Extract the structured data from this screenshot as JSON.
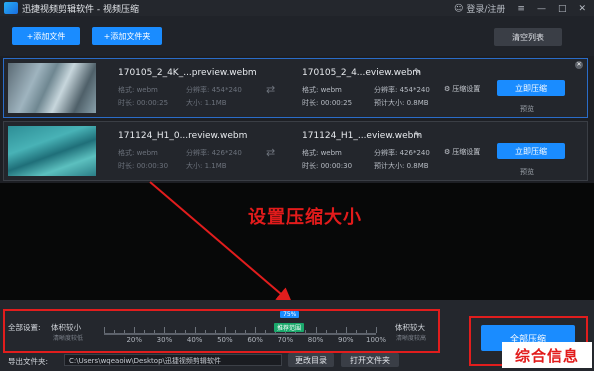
{
  "app": {
    "title": "迅捷视频剪辑软件 - 视频压缩",
    "login_label": "登录/注册",
    "window_controls": {
      "menu": "≡",
      "minimize": "—",
      "maximize": "□",
      "close": "✕"
    }
  },
  "toolbar": {
    "add_file": "+添加文件",
    "add_folder": "+添加文件夹",
    "clear_list": "清空列表"
  },
  "files": [
    {
      "source_name": "170105_2_4K_...preview.webm",
      "format_label": "格式: webm",
      "resolution_label": "分辨率: 454*240",
      "duration_label": "时长: 00:00:25",
      "size_label": "大小: 1.1MB",
      "output_name": "170105_2_4...eview.webm",
      "out_format": "格式: webm",
      "out_resolution": "分辨率: 454*240",
      "out_duration": "时长: 00:00:25",
      "out_size": "预计大小: 0.8MB",
      "compress_settings": "压缩设置",
      "compress_now": "立即压缩",
      "preview": "预览"
    },
    {
      "source_name": "171124_H1_0...review.webm",
      "format_label": "格式: webm",
      "resolution_label": "分辨率: 426*240",
      "duration_label": "时长: 00:00:30",
      "size_label": "大小: 1.1MB",
      "output_name": "171124_H1_...eview.webm",
      "out_format": "格式: webm",
      "out_resolution": "分辨率: 426*240",
      "out_duration": "时长: 00:00:30",
      "out_size": "预计大小: 0.8MB",
      "compress_settings": "压缩设置",
      "compress_now": "立即压缩",
      "preview": "预览"
    }
  ],
  "annotation": "设置压缩大小",
  "global_settings": {
    "label": "全部设置:",
    "min_label": "体积较小",
    "min_sub": "清晰度较低",
    "max_label": "体积较大",
    "max_sub": "清晰度较高",
    "value_badge": "75%",
    "recommended_badge": "推荐范围",
    "current_percent": 75,
    "ticks": [
      "20%",
      "30%",
      "40%",
      "50%",
      "60%",
      "70%",
      "80%",
      "90%",
      "100%"
    ]
  },
  "output": {
    "label": "导出文件夹:",
    "path": "C:\\Users\\wqeaoiw\\Desktop\\迅捷视频剪辑软件",
    "change_dir": "更改目录",
    "open_folder": "打开文件夹"
  },
  "compress_all": "全部压缩",
  "watermark": "综合信息",
  "colors": {
    "accent": "#1a8cff",
    "annotation": "#e11d1d",
    "recommended": "#1aa86b"
  }
}
